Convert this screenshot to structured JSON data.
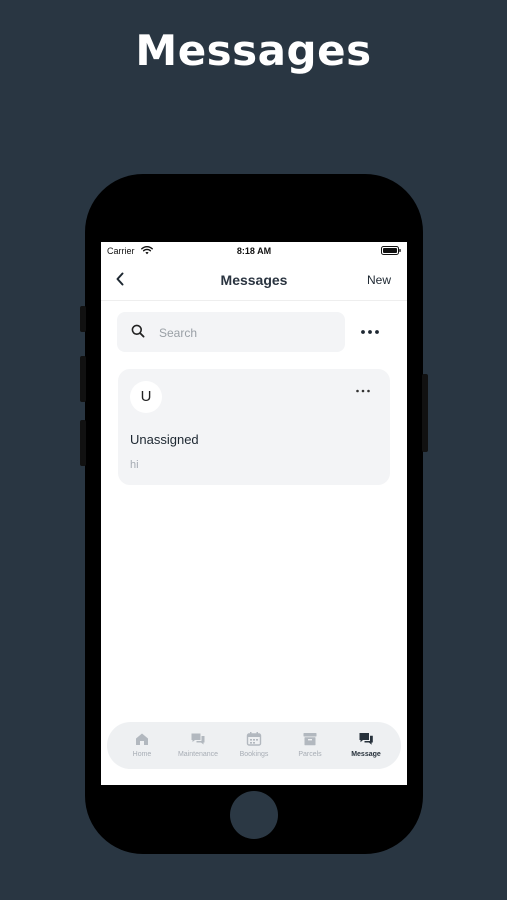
{
  "hero": {
    "title": "Messages"
  },
  "status_bar": {
    "carrier": "Carrier",
    "time": "8:18 AM"
  },
  "nav": {
    "title": "Messages",
    "new_label": "New"
  },
  "search": {
    "placeholder": "Search",
    "value": ""
  },
  "conversations": [
    {
      "avatar_initial": "U",
      "title": "Unassigned",
      "preview": "hi"
    }
  ],
  "tabs": [
    {
      "label": "Home",
      "icon": "home-icon"
    },
    {
      "label": "Maintenance",
      "icon": "chat-icon"
    },
    {
      "label": "Bookings",
      "icon": "calendar-icon"
    },
    {
      "label": "Parcels",
      "icon": "archive-box-icon"
    },
    {
      "label": "Message",
      "icon": "message-icon",
      "active": true
    }
  ],
  "colors": {
    "background": "#293642",
    "accent": "#27313b",
    "inactive": "#a7adb5"
  }
}
